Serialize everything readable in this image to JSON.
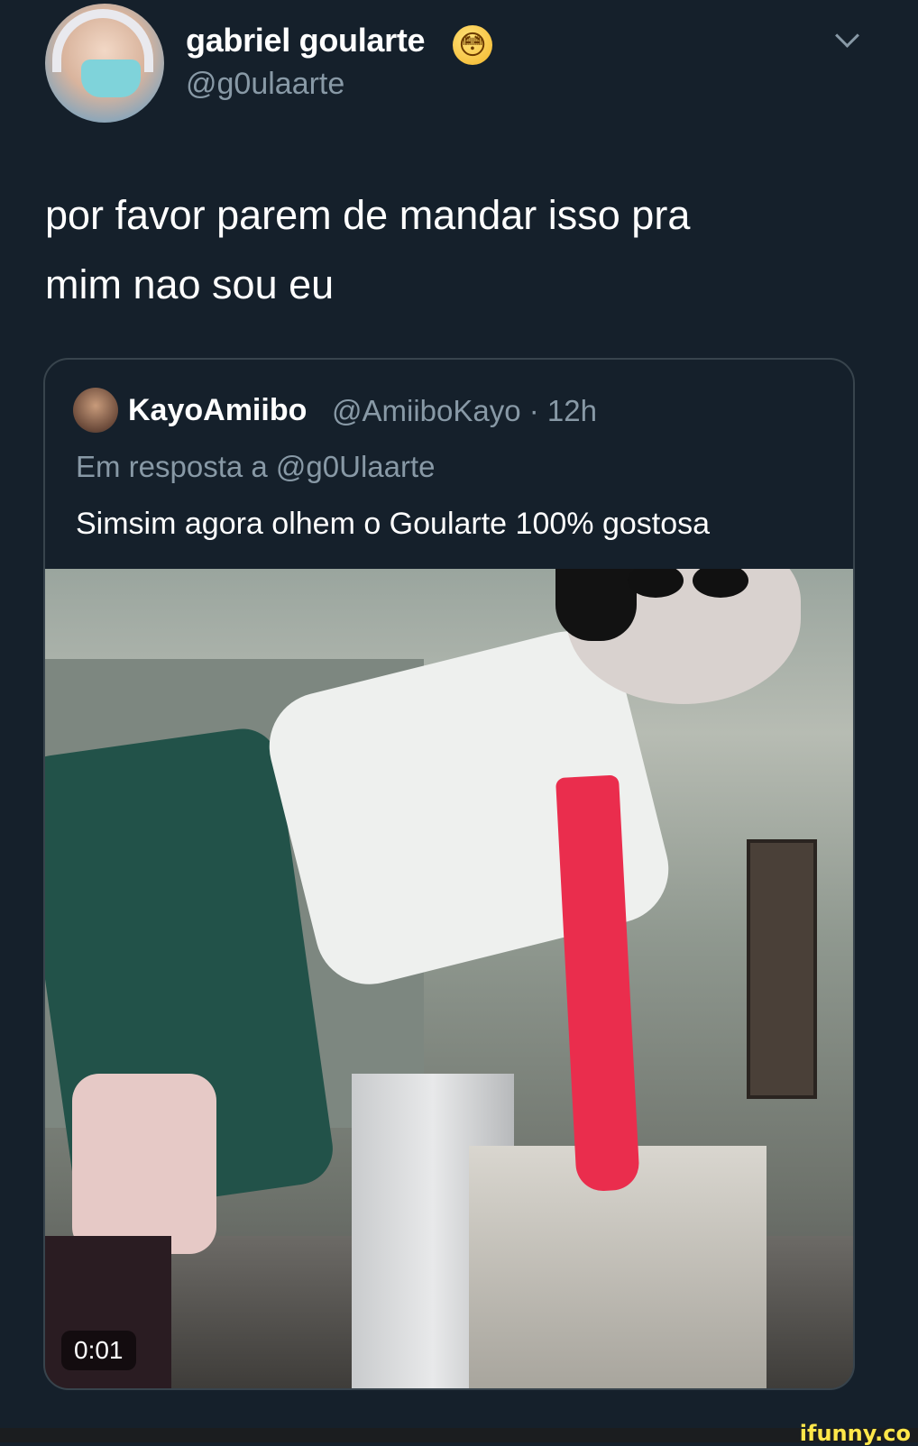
{
  "tweet": {
    "display_name": "gabriel goularte",
    "emoji": "😳",
    "handle": "@g0ulaarte",
    "text_line1": "por favor parem de mandar isso pra",
    "text_line2": "mim nao sou eu"
  },
  "quoted_tweet": {
    "display_name": "KayoAmiibo",
    "handle_time": "@AmiiboKayo · 12h",
    "reply_context": "Em resposta a @g0Ulaarte",
    "text": "Simsim agora olhem o Goularte 100% gostosa",
    "video_timestamp": "0:01"
  },
  "watermark": "ifunny.co",
  "colors": {
    "background": "#15202b",
    "secondary_text": "#8899a6",
    "border": "#38444d",
    "watermark": "#ffe74a"
  },
  "icons": [
    "chevron-down-icon"
  ]
}
